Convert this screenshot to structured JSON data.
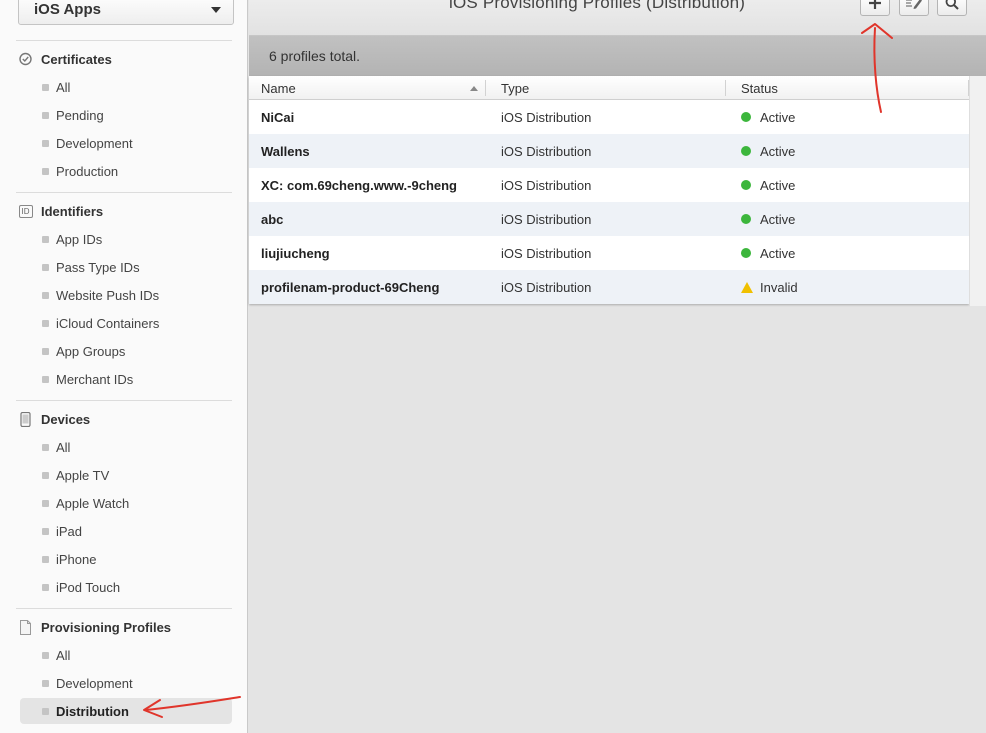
{
  "sidebar": {
    "app_selector": "iOS Apps",
    "sections": [
      {
        "title": "Certificates",
        "icon": "certificate-icon",
        "items": [
          "All",
          "Pending",
          "Development",
          "Production"
        ]
      },
      {
        "title": "Identifiers",
        "icon": "id-icon",
        "icon_text": "ID",
        "items": [
          "App IDs",
          "Pass Type IDs",
          "Website Push IDs",
          "iCloud Containers",
          "App Groups",
          "Merchant IDs"
        ]
      },
      {
        "title": "Devices",
        "icon": "device-icon",
        "items": [
          "All",
          "Apple TV",
          "Apple Watch",
          "iPad",
          "iPhone",
          "iPod Touch"
        ]
      },
      {
        "title": "Provisioning Profiles",
        "icon": "document-icon",
        "items": [
          "All",
          "Development",
          "Distribution"
        ]
      }
    ],
    "active_item": "Distribution"
  },
  "header": {
    "title": "iOS Provisioning Profiles (Distribution)",
    "buttons": [
      "add-icon",
      "edit-icon",
      "search-icon"
    ]
  },
  "summary": "6 profiles total.",
  "table": {
    "columns": [
      "Name",
      "Type",
      "Status"
    ],
    "rows": [
      {
        "name": "NiCai",
        "type": "iOS Distribution",
        "status": "Active"
      },
      {
        "name": "Wallens",
        "type": "iOS Distribution",
        "status": "Active"
      },
      {
        "name": "XC: com.69cheng.www.-9cheng",
        "type": "iOS Distribution",
        "status": "Active"
      },
      {
        "name": "abc",
        "type": "iOS Distribution",
        "status": "Active"
      },
      {
        "name": "liujiucheng",
        "type": "iOS Distribution",
        "status": "Active"
      },
      {
        "name": "profilenam-product-69Cheng",
        "type": "iOS Distribution",
        "status": "Invalid"
      }
    ]
  },
  "colors": {
    "active": "#3cb63c",
    "invalid": "#f0c000",
    "annotation": "#e0352b"
  }
}
